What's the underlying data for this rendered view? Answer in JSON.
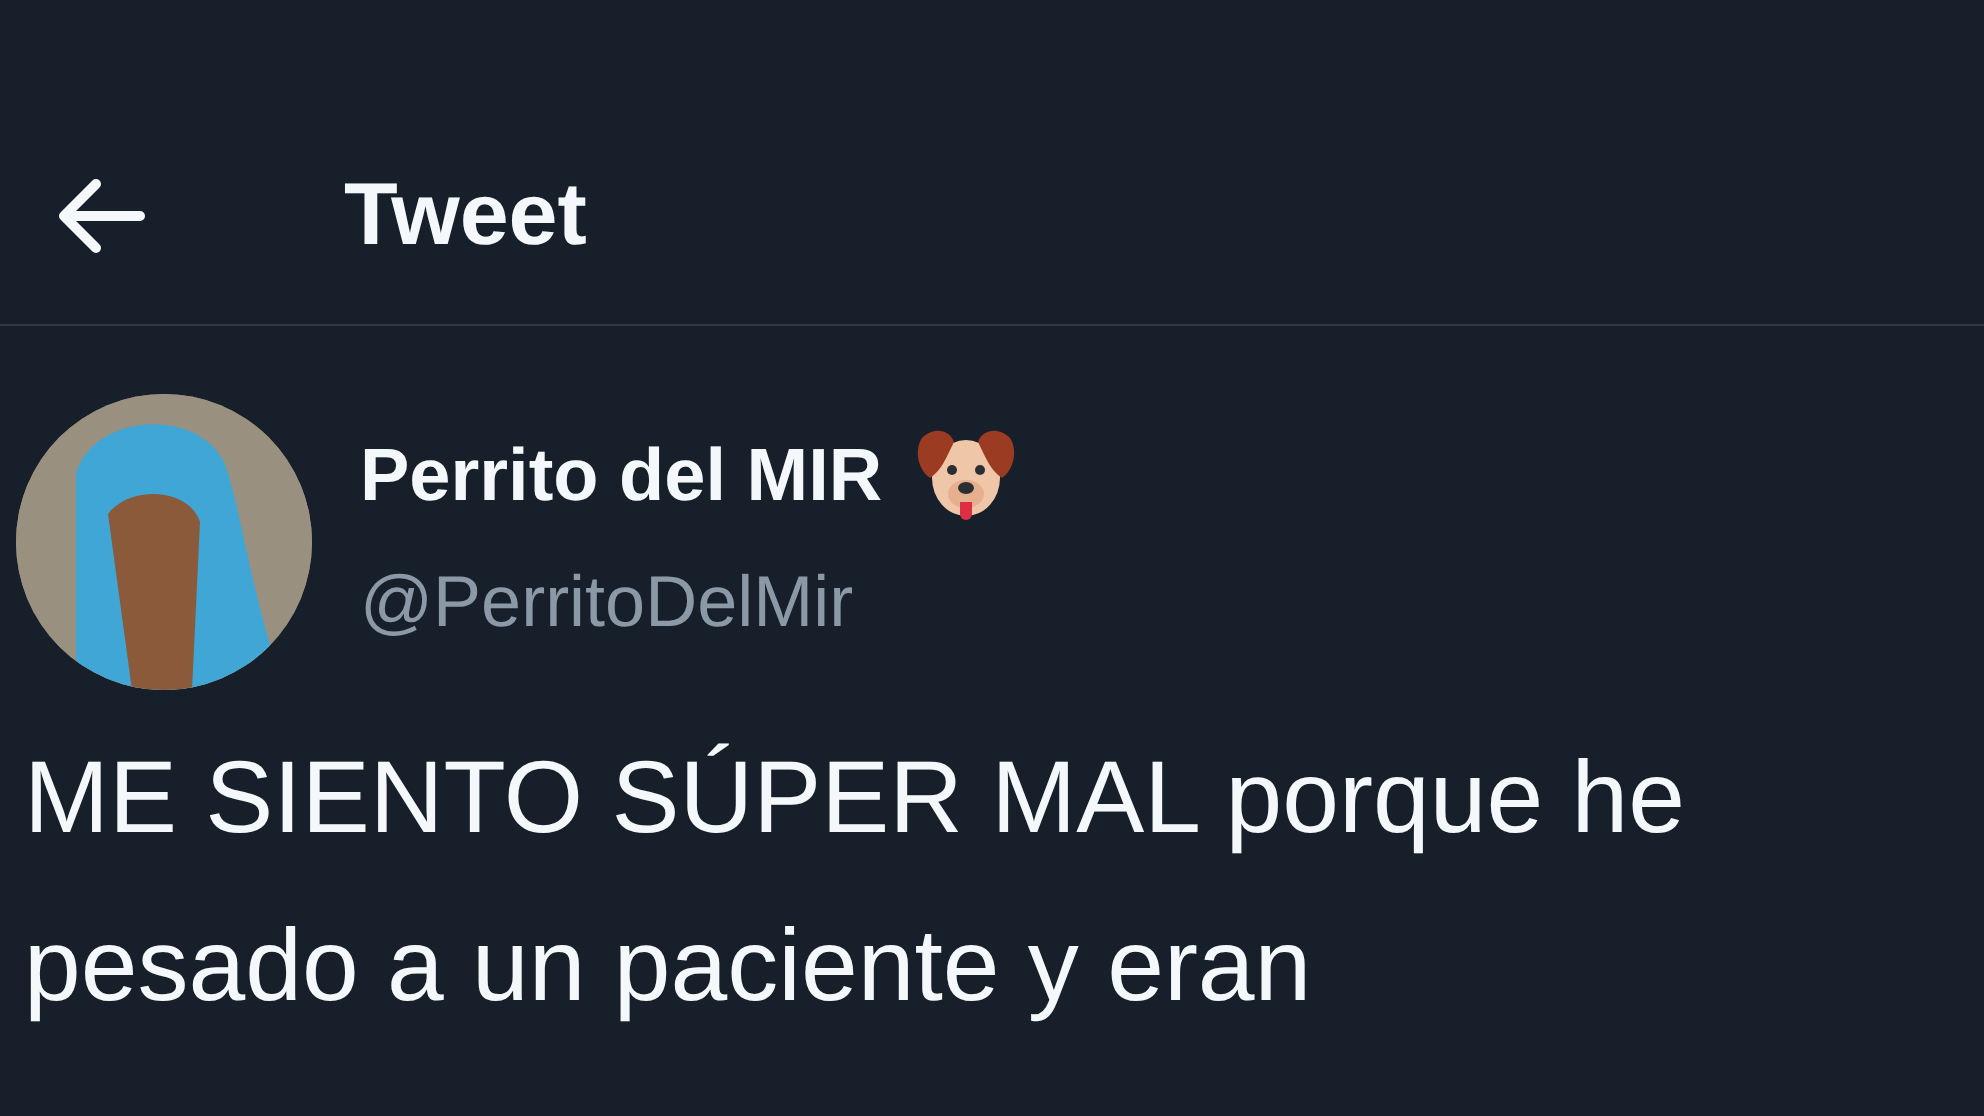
{
  "header": {
    "title": "Tweet"
  },
  "author": {
    "name": "Perrito del MIR",
    "handle": "@PerritoDelMir"
  },
  "tweet": {
    "text": "ME SIENTO SÚPER MAL porque he pesado a un paciente y eran"
  }
}
